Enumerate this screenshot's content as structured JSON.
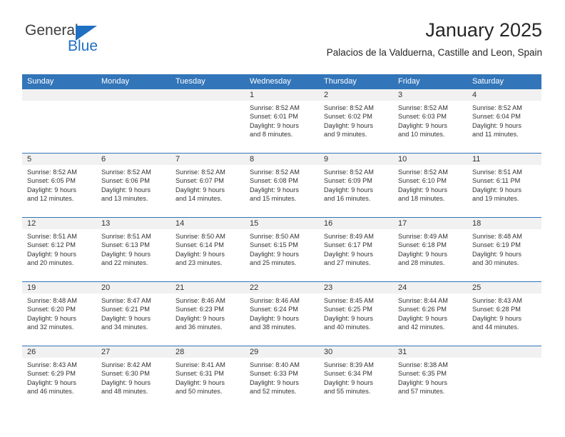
{
  "brand": {
    "name_part1": "General",
    "name_part2": "Blue",
    "triangle_color": "#1f70c1"
  },
  "header": {
    "title": "January 2025",
    "subtitle": "Palacios de la Valduerna, Castille and Leon, Spain",
    "header_bg_color": "#3275b9"
  },
  "weekday_headers": [
    "Sunday",
    "Monday",
    "Tuesday",
    "Wednesday",
    "Thursday",
    "Friday",
    "Saturday"
  ],
  "weeks": [
    [
      {
        "day": "",
        "sunrise": "",
        "sunset": "",
        "daylight_line1": "",
        "daylight_line2": "",
        "empty": true
      },
      {
        "day": "",
        "sunrise": "",
        "sunset": "",
        "daylight_line1": "",
        "daylight_line2": "",
        "empty": true
      },
      {
        "day": "",
        "sunrise": "",
        "sunset": "",
        "daylight_line1": "",
        "daylight_line2": "",
        "empty": true
      },
      {
        "day": "1",
        "sunrise": "Sunrise: 8:52 AM",
        "sunset": "Sunset: 6:01 PM",
        "daylight_line1": "Daylight: 9 hours",
        "daylight_line2": "and 8 minutes."
      },
      {
        "day": "2",
        "sunrise": "Sunrise: 8:52 AM",
        "sunset": "Sunset: 6:02 PM",
        "daylight_line1": "Daylight: 9 hours",
        "daylight_line2": "and 9 minutes."
      },
      {
        "day": "3",
        "sunrise": "Sunrise: 8:52 AM",
        "sunset": "Sunset: 6:03 PM",
        "daylight_line1": "Daylight: 9 hours",
        "daylight_line2": "and 10 minutes."
      },
      {
        "day": "4",
        "sunrise": "Sunrise: 8:52 AM",
        "sunset": "Sunset: 6:04 PM",
        "daylight_line1": "Daylight: 9 hours",
        "daylight_line2": "and 11 minutes."
      }
    ],
    [
      {
        "day": "5",
        "sunrise": "Sunrise: 8:52 AM",
        "sunset": "Sunset: 6:05 PM",
        "daylight_line1": "Daylight: 9 hours",
        "daylight_line2": "and 12 minutes."
      },
      {
        "day": "6",
        "sunrise": "Sunrise: 8:52 AM",
        "sunset": "Sunset: 6:06 PM",
        "daylight_line1": "Daylight: 9 hours",
        "daylight_line2": "and 13 minutes."
      },
      {
        "day": "7",
        "sunrise": "Sunrise: 8:52 AM",
        "sunset": "Sunset: 6:07 PM",
        "daylight_line1": "Daylight: 9 hours",
        "daylight_line2": "and 14 minutes."
      },
      {
        "day": "8",
        "sunrise": "Sunrise: 8:52 AM",
        "sunset": "Sunset: 6:08 PM",
        "daylight_line1": "Daylight: 9 hours",
        "daylight_line2": "and 15 minutes."
      },
      {
        "day": "9",
        "sunrise": "Sunrise: 8:52 AM",
        "sunset": "Sunset: 6:09 PM",
        "daylight_line1": "Daylight: 9 hours",
        "daylight_line2": "and 16 minutes."
      },
      {
        "day": "10",
        "sunrise": "Sunrise: 8:52 AM",
        "sunset": "Sunset: 6:10 PM",
        "daylight_line1": "Daylight: 9 hours",
        "daylight_line2": "and 18 minutes."
      },
      {
        "day": "11",
        "sunrise": "Sunrise: 8:51 AM",
        "sunset": "Sunset: 6:11 PM",
        "daylight_line1": "Daylight: 9 hours",
        "daylight_line2": "and 19 minutes."
      }
    ],
    [
      {
        "day": "12",
        "sunrise": "Sunrise: 8:51 AM",
        "sunset": "Sunset: 6:12 PM",
        "daylight_line1": "Daylight: 9 hours",
        "daylight_line2": "and 20 minutes."
      },
      {
        "day": "13",
        "sunrise": "Sunrise: 8:51 AM",
        "sunset": "Sunset: 6:13 PM",
        "daylight_line1": "Daylight: 9 hours",
        "daylight_line2": "and 22 minutes."
      },
      {
        "day": "14",
        "sunrise": "Sunrise: 8:50 AM",
        "sunset": "Sunset: 6:14 PM",
        "daylight_line1": "Daylight: 9 hours",
        "daylight_line2": "and 23 minutes."
      },
      {
        "day": "15",
        "sunrise": "Sunrise: 8:50 AM",
        "sunset": "Sunset: 6:15 PM",
        "daylight_line1": "Daylight: 9 hours",
        "daylight_line2": "and 25 minutes."
      },
      {
        "day": "16",
        "sunrise": "Sunrise: 8:49 AM",
        "sunset": "Sunset: 6:17 PM",
        "daylight_line1": "Daylight: 9 hours",
        "daylight_line2": "and 27 minutes."
      },
      {
        "day": "17",
        "sunrise": "Sunrise: 8:49 AM",
        "sunset": "Sunset: 6:18 PM",
        "daylight_line1": "Daylight: 9 hours",
        "daylight_line2": "and 28 minutes."
      },
      {
        "day": "18",
        "sunrise": "Sunrise: 8:48 AM",
        "sunset": "Sunset: 6:19 PM",
        "daylight_line1": "Daylight: 9 hours",
        "daylight_line2": "and 30 minutes."
      }
    ],
    [
      {
        "day": "19",
        "sunrise": "Sunrise: 8:48 AM",
        "sunset": "Sunset: 6:20 PM",
        "daylight_line1": "Daylight: 9 hours",
        "daylight_line2": "and 32 minutes."
      },
      {
        "day": "20",
        "sunrise": "Sunrise: 8:47 AM",
        "sunset": "Sunset: 6:21 PM",
        "daylight_line1": "Daylight: 9 hours",
        "daylight_line2": "and 34 minutes."
      },
      {
        "day": "21",
        "sunrise": "Sunrise: 8:46 AM",
        "sunset": "Sunset: 6:23 PM",
        "daylight_line1": "Daylight: 9 hours",
        "daylight_line2": "and 36 minutes."
      },
      {
        "day": "22",
        "sunrise": "Sunrise: 8:46 AM",
        "sunset": "Sunset: 6:24 PM",
        "daylight_line1": "Daylight: 9 hours",
        "daylight_line2": "and 38 minutes."
      },
      {
        "day": "23",
        "sunrise": "Sunrise: 8:45 AM",
        "sunset": "Sunset: 6:25 PM",
        "daylight_line1": "Daylight: 9 hours",
        "daylight_line2": "and 40 minutes."
      },
      {
        "day": "24",
        "sunrise": "Sunrise: 8:44 AM",
        "sunset": "Sunset: 6:26 PM",
        "daylight_line1": "Daylight: 9 hours",
        "daylight_line2": "and 42 minutes."
      },
      {
        "day": "25",
        "sunrise": "Sunrise: 8:43 AM",
        "sunset": "Sunset: 6:28 PM",
        "daylight_line1": "Daylight: 9 hours",
        "daylight_line2": "and 44 minutes."
      }
    ],
    [
      {
        "day": "26",
        "sunrise": "Sunrise: 8:43 AM",
        "sunset": "Sunset: 6:29 PM",
        "daylight_line1": "Daylight: 9 hours",
        "daylight_line2": "and 46 minutes."
      },
      {
        "day": "27",
        "sunrise": "Sunrise: 8:42 AM",
        "sunset": "Sunset: 6:30 PM",
        "daylight_line1": "Daylight: 9 hours",
        "daylight_line2": "and 48 minutes."
      },
      {
        "day": "28",
        "sunrise": "Sunrise: 8:41 AM",
        "sunset": "Sunset: 6:31 PM",
        "daylight_line1": "Daylight: 9 hours",
        "daylight_line2": "and 50 minutes."
      },
      {
        "day": "29",
        "sunrise": "Sunrise: 8:40 AM",
        "sunset": "Sunset: 6:33 PM",
        "daylight_line1": "Daylight: 9 hours",
        "daylight_line2": "and 52 minutes."
      },
      {
        "day": "30",
        "sunrise": "Sunrise: 8:39 AM",
        "sunset": "Sunset: 6:34 PM",
        "daylight_line1": "Daylight: 9 hours",
        "daylight_line2": "and 55 minutes."
      },
      {
        "day": "31",
        "sunrise": "Sunrise: 8:38 AM",
        "sunset": "Sunset: 6:35 PM",
        "daylight_line1": "Daylight: 9 hours",
        "daylight_line2": "and 57 minutes."
      },
      {
        "day": "",
        "sunrise": "",
        "sunset": "",
        "daylight_line1": "",
        "daylight_line2": "",
        "empty": true
      }
    ]
  ]
}
